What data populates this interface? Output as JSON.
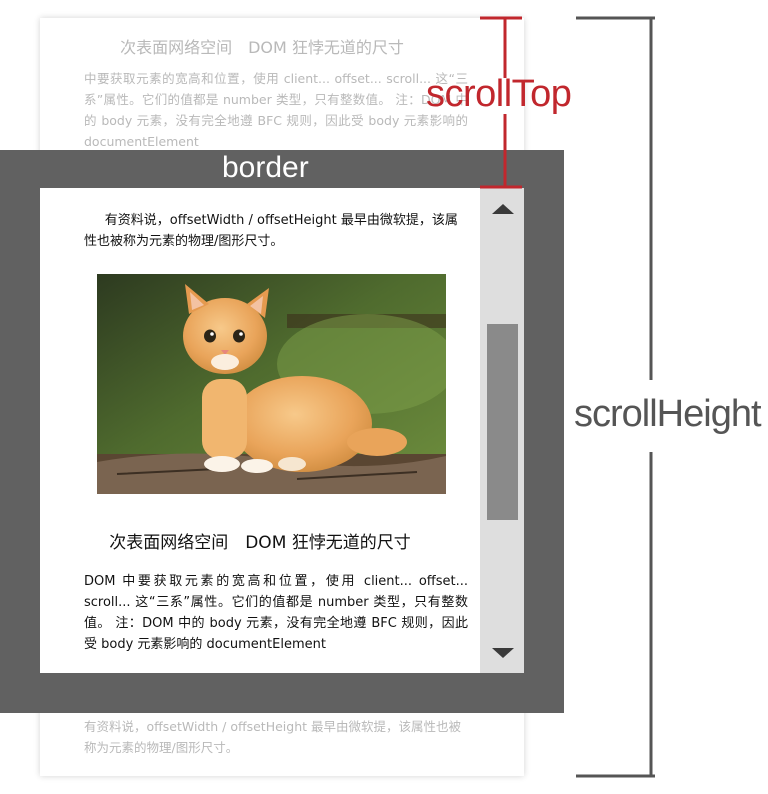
{
  "content": {
    "heading": "次表面网络空间　DOM 狂悖无道的尺寸",
    "paragraph_intro": "有资料说，offsetWidth / offsetHeight 最早由微软提，该属性也被称为元素的物理/图形尺寸。",
    "paragraph_body": "DOM 中要获取元素的宽高和位置，使用 client... offset... scroll... 这“三系”属性。它们的值都是 number 类型，只有整数值。 注：DOM 中的 body 元素，没有完全地遵 BFC 规则，因此受 body 元素影响的 documentElement",
    "ghost_paragraph_top": "中要获取元素的宽高和位置，使用 client... offset... scroll... 这“三系”属性。它们的值都是 number 类型，只有整数值。 注：DOM 中的 body 元素，没有完全地遵 BFC 规则，因此受 body 元素影响的 documentElement"
  },
  "labels": {
    "border": "border",
    "scroll_top": "scrollTop",
    "scroll_height": "scrollHeight"
  },
  "image": {
    "icon": "kitten-photo"
  },
  "colors": {
    "border_frame": "#616161",
    "scroll_top_accent": "#c1272d",
    "scroll_height_bracket": "#555555",
    "scrollbar_track": "#dedede",
    "scrollbar_thumb": "#8a8a8a"
  }
}
